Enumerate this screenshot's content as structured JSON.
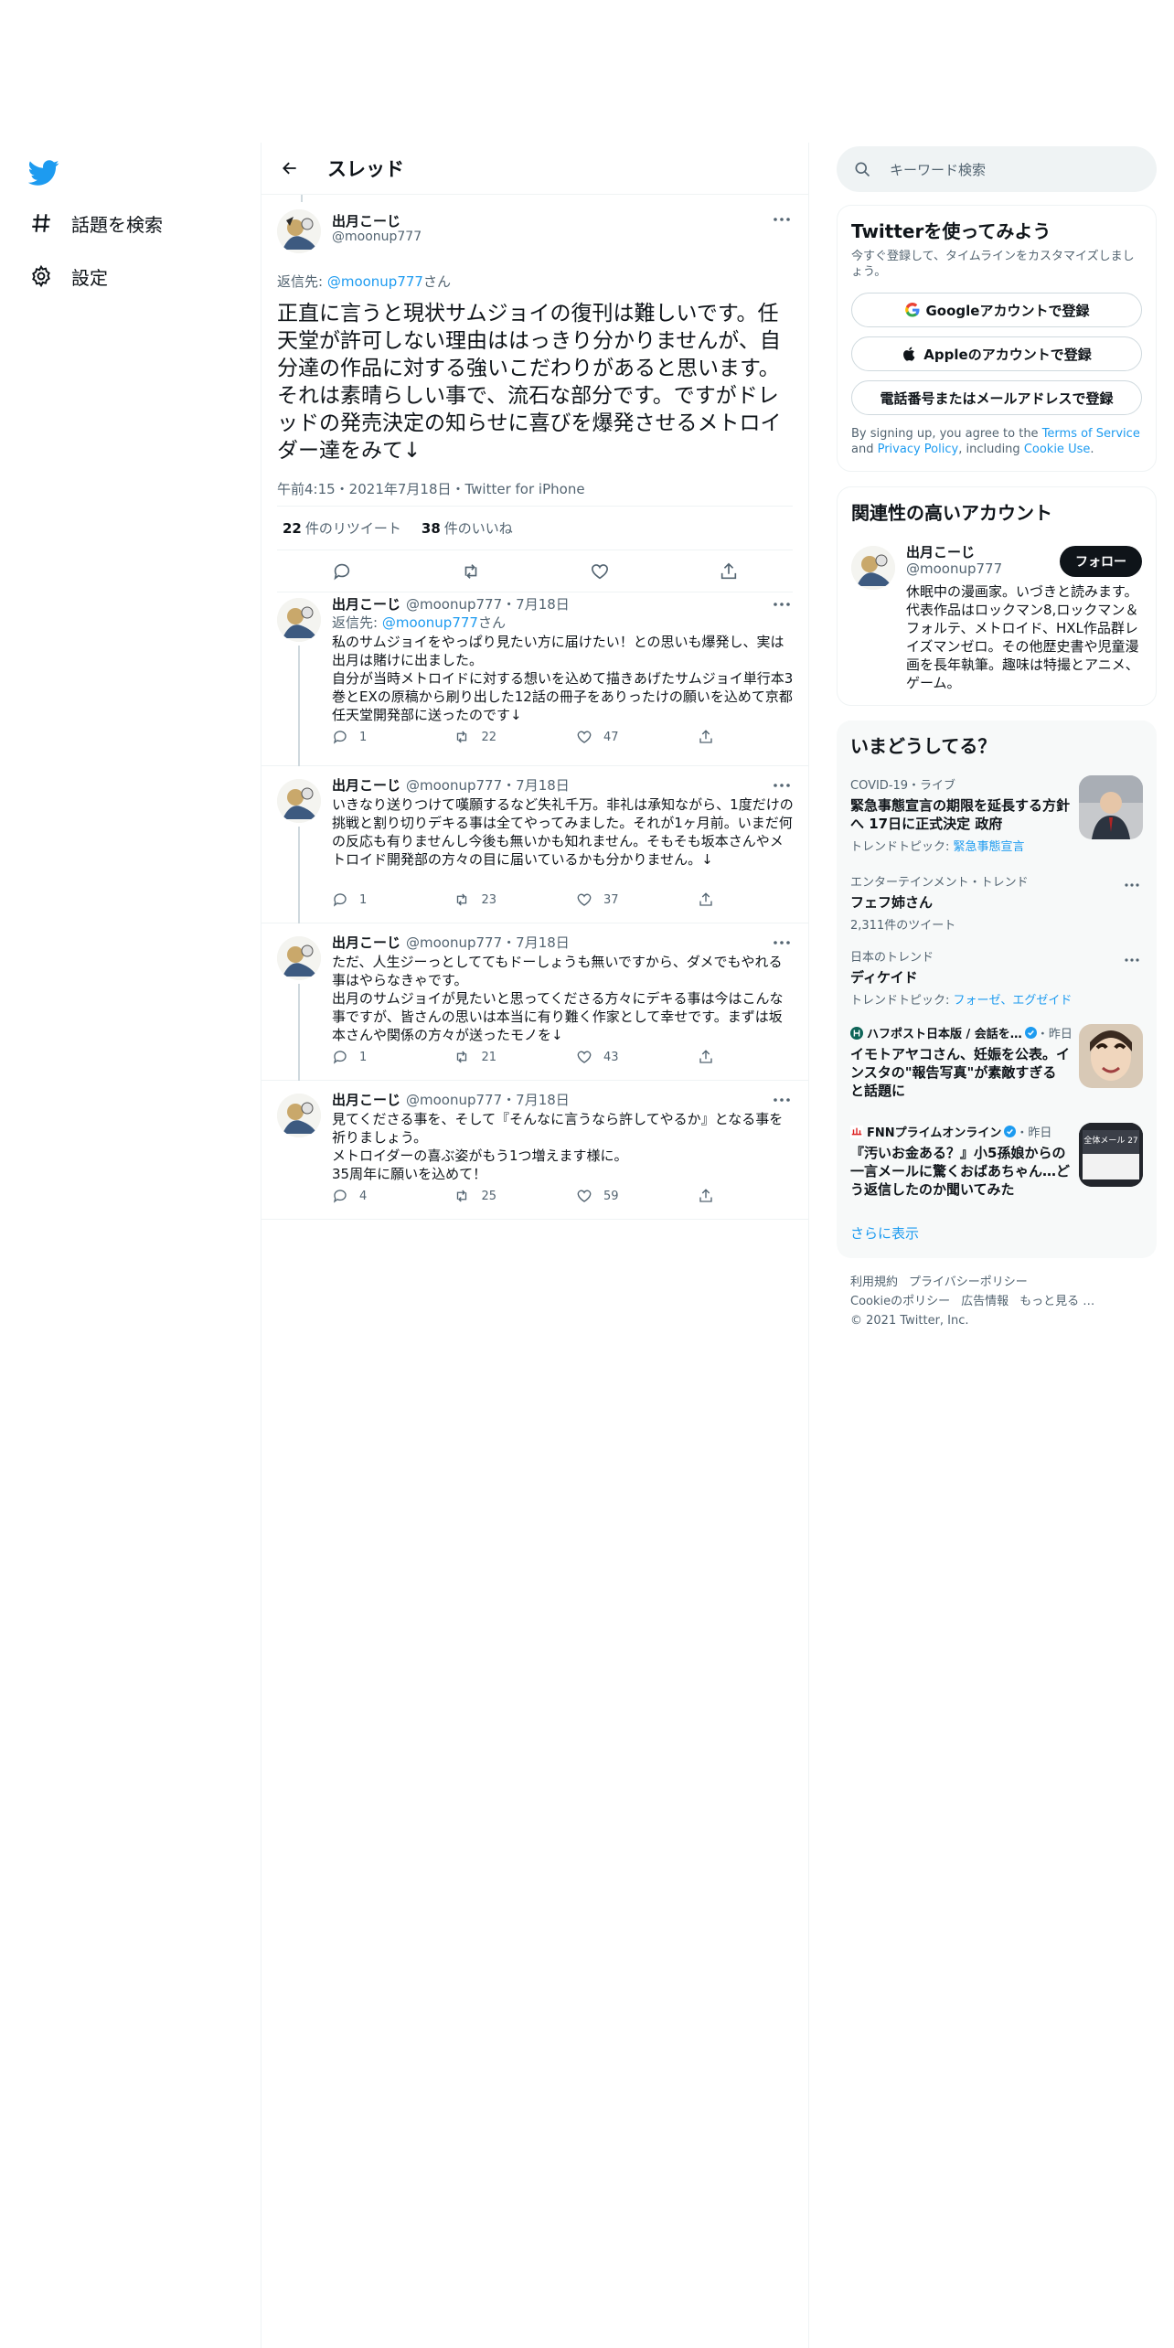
{
  "nav": {
    "items": [
      {
        "label": "話題を検索",
        "icon": "hashtag-icon"
      },
      {
        "label": "設定",
        "icon": "gear-icon"
      }
    ]
  },
  "header": {
    "title": "スレッド"
  },
  "main_tweet": {
    "name": "出月こーじ",
    "handle": "@moonup777",
    "replying_prefix": "返信先: ",
    "replying_handle": "@moonup777",
    "replying_suffix": "さん",
    "text": "正直に言うと現状サムジョイの復刊は難しいです。任天堂が許可しない理由ははっきり分かりませんが、自分達の作品に対する強いこだわりがあると思います。それは素晴らしい事で、流石な部分です。ですがドレッドの発売決定の知らせに喜びを爆発させるメトロイダー達をみて↓",
    "meta": "午前4:15・2021年7月18日・Twitter for iPhone",
    "retweets": "22",
    "retweets_label": "件のリツイート",
    "likes": "38",
    "likes_label": "件のいいね"
  },
  "replies": [
    {
      "name": "出月こーじ",
      "sub": "@moonup777・7月18日",
      "replying_prefix": "返信先: ",
      "replying_handle": "@moonup777",
      "replying_suffix": "さん",
      "text": "私のサムジョイをやっぱり見たい方に届けたい！との思いも爆発し、実は出月は賭けに出ました。\n自分が当時メトロイドに対する想いを込めて描きあげたサムジョイ単行本3巻とEXの原稿から刷り出した12話の冊子をありったけの願いを込めて京都任天堂開発部に送ったのです↓",
      "replies": "1",
      "retweets": "22",
      "likes": "47"
    },
    {
      "name": "出月こーじ",
      "sub": "@moonup777・7月18日",
      "text": "いきなり送りつけて嘆願するなど失礼千万。非礼は承知ながら、1度だけの挑戦と割り切りデキる事は全てやってみました。それが1ヶ月前。いまだ何の反応も有りませんし今後も無いかも知れません。そもそも坂本さんやメトロイド開発部の方々の目に届いているかも分かりません。↓",
      "replies": "1",
      "retweets": "23",
      "likes": "37"
    },
    {
      "name": "出月こーじ",
      "sub": "@moonup777・7月18日",
      "text": "ただ、人生ジーっとしててもドーしょうも無いですから、ダメでもやれる事はやらなきゃです。\n出月のサムジョイが見たいと思ってくださる方々にデキる事は今はこんな事ですが、皆さんの思いは本当に有り難く作家として幸せです。まずは坂本さんや関係の方々が送ったモノを↓",
      "replies": "1",
      "retweets": "21",
      "likes": "43"
    },
    {
      "name": "出月こーじ",
      "sub": "@moonup777・7月18日",
      "text": "見てくださる事を、そして『そんなに言うなら許してやるか』となる事を祈りましょう。\nメトロイダーの喜ぶ姿がもう1つ増えます様に。\n35周年に願いを込めて！",
      "replies": "4",
      "retweets": "25",
      "likes": "59"
    }
  ],
  "search": {
    "placeholder": "キーワード検索"
  },
  "signup": {
    "title": "Twitterを使ってみよう",
    "desc": "今すぐ登録して、タイムラインをカスタマイズしましょう。",
    "google": "Googleアカウントで登録",
    "apple": "Appleのアカウントで登録",
    "phone": "電話番号またはメールアドレスで登録",
    "terms_1": "By signing up, you agree to the ",
    "terms_link1": "Terms of Service",
    "terms_2": " and ",
    "terms_link2": "Privacy Policy",
    "terms_3": ", including ",
    "terms_link3": "Cookie Use",
    "terms_4": "."
  },
  "related": {
    "title": "関連性の高いアカウント",
    "name": "出月こーじ",
    "handle": "@moonup777",
    "follow": "フォロー",
    "bio": "休眠中の漫画家。いづきと読みます。代表作品はロックマン8,ロックマン＆フォルテ、メトロイド、HXL作品群レイズマンゼロ。その他歴史書や児童漫画を長年執筆。趣味は特撮とアニメ、ゲーム。"
  },
  "trends": {
    "title": "いまどうしてる？",
    "items": [
      {
        "meta": "COVID-19・ライブ",
        "title": "緊急事態宣言の期限を延長する方針へ 17日に正式決定 政府",
        "sub_prefix": "トレンドトピック: ",
        "sub_link": "緊急事態宣言"
      },
      {
        "meta": "エンターテインメント・トレンド",
        "title": "フェフ姉さん",
        "sub": "2,311件のツイート"
      },
      {
        "meta": "日本のトレンド",
        "title": "ディケイド",
        "sub_prefix": "トレンドトピック: ",
        "sub_link": "フォーゼ、エグゼイド"
      },
      {
        "meta_source": "ハフポスト日本版 / 会話を…",
        "meta_time": "・昨日",
        "title": "イモトアヤコさん、妊娠を公表。インスタの\"報告写真\"が素敵すぎると話題に"
      },
      {
        "meta_source": "FNNプライムオンライン",
        "meta_time": "・昨日",
        "title": "『汚いお金ある？』小5孫娘からの一言メールに驚くおばあちゃん…どう返信したのか聞いてみた",
        "thumb_text": "全体メール 27"
      }
    ],
    "show_more": "さらに表示"
  },
  "footer": {
    "links": [
      "利用規約",
      "プライバシーポリシー",
      "Cookieのポリシー",
      "広告情報",
      "もっと見る …"
    ],
    "copyright": "© 2021 Twitter, Inc."
  },
  "colors": {
    "accent": "#1d9bf0",
    "text": "#0f1419",
    "muted": "#536471",
    "border": "#eff3f4"
  }
}
